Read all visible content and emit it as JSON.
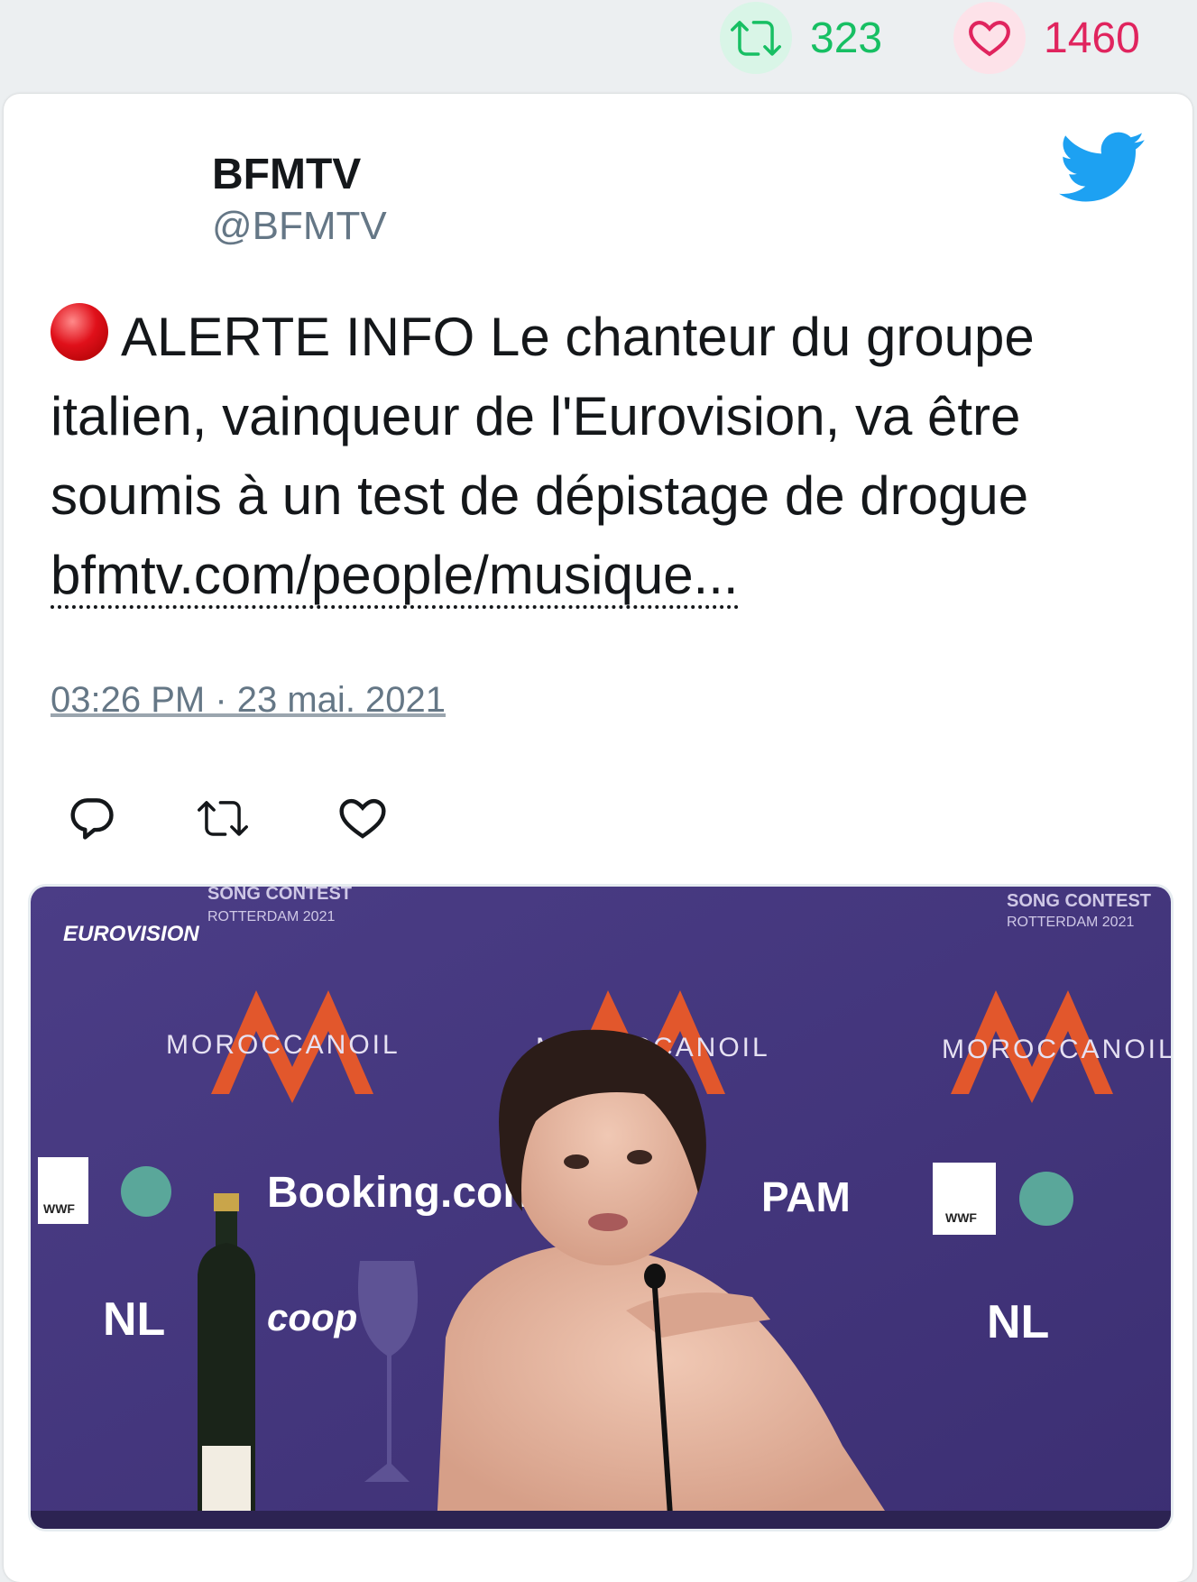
{
  "top_stats": {
    "retweets": "323",
    "likes": "1460"
  },
  "colors": {
    "retweet_green": "#17bf63",
    "like_red": "#e0245e",
    "twitter_blue": "#1da1f2"
  },
  "tweet": {
    "author_name": "BFMTV",
    "author_handle": "@BFMTV",
    "text": "ALERTE INFO Le chanteur du groupe italien, vainqueur de l'Eurovision, va être soumis à un test de dépistage de drogue",
    "link": "bfmtv.com/people/musique...",
    "timestamp": "03:26 PM · 23 mai. 2021"
  },
  "icons": {
    "status": "red-circle-icon",
    "logo": "twitter-bird-icon",
    "reply": "reply-icon",
    "retweet": "retweet-icon",
    "like": "heart-icon"
  },
  "media": {
    "backdrop_brand": "MOROCCANOIL",
    "event_lines": [
      "SONG CONTEST",
      "ROTTERDAM 2021"
    ],
    "logo_text": "EUROVISION",
    "sponsor_text": "Booking.com",
    "sponsor_partial": "PAM",
    "nl_text": "NL",
    "coop_text": "coop",
    "wwf_text": "WWF"
  }
}
